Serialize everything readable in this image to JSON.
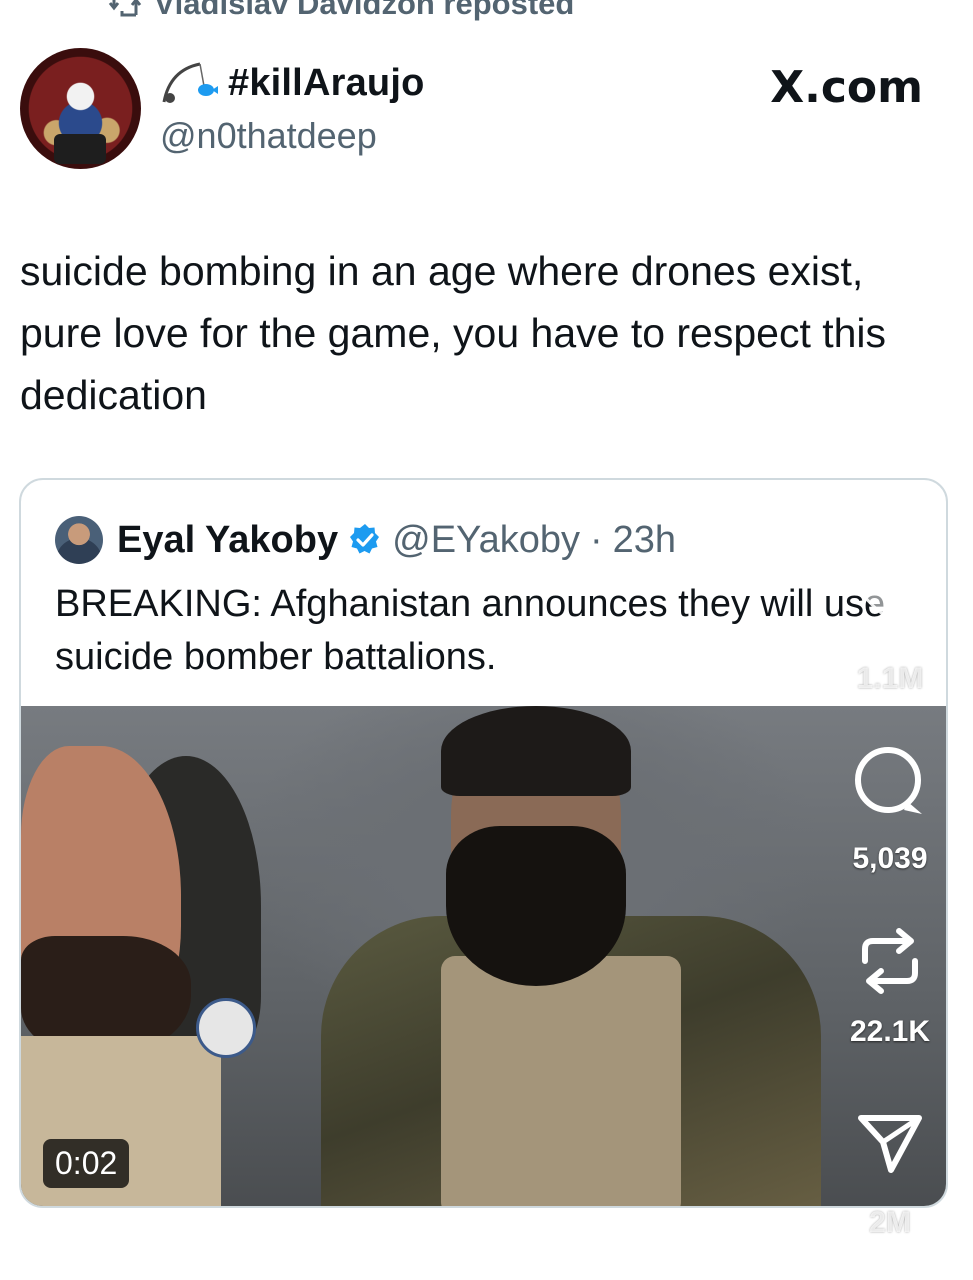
{
  "repost": {
    "label": "Vladislav Davidzon reposted",
    "icon": "repost-icon"
  },
  "author": {
    "display_name": "#killAraujo",
    "name_icon": "fishing-rod-icon",
    "handle": "@n0thatdeep"
  },
  "source_label": "X.com",
  "tweet": {
    "text": "suicide bombing in an age where drones exist, pure love for the game, you have to respect this dedication"
  },
  "quote": {
    "name": "Eyal Yakoby",
    "verified_icon": "verified-badge-icon",
    "handle": "@EYakoby",
    "separator": "·",
    "time": "23h",
    "text": "BREAKING: Afghanistan announces they will use suicide bomber battalions.",
    "video_duration": "0:02"
  },
  "overlay": {
    "likes": "1.1M",
    "comments": "5,039",
    "reposts": "22.1K",
    "shares": "2M"
  },
  "colors": {
    "text": "#0f1419",
    "secondary": "#536471",
    "verified": "#1d9bf0",
    "border": "#cfd9de"
  }
}
